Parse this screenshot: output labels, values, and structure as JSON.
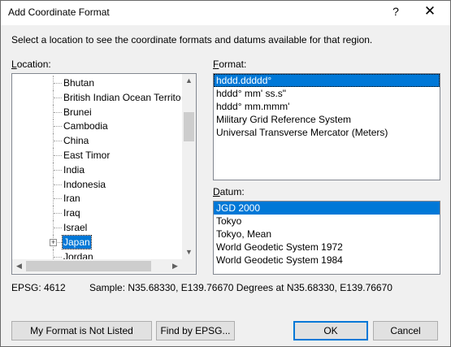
{
  "window": {
    "title": "Add Coordinate Format",
    "help_label": "?",
    "close_label": "✕"
  },
  "instruction": "Select a location to see the coordinate formats and datums available for that region.",
  "location": {
    "label_mnemonic": "L",
    "label_rest": "ocation:",
    "items": [
      {
        "label": "Bhutan",
        "selected": false
      },
      {
        "label": "British Indian Ocean Territory",
        "selected": false
      },
      {
        "label": "Brunei",
        "selected": false
      },
      {
        "label": "Cambodia",
        "selected": false
      },
      {
        "label": "China",
        "selected": false
      },
      {
        "label": "East Timor",
        "selected": false
      },
      {
        "label": "India",
        "selected": false
      },
      {
        "label": "Indonesia",
        "selected": false
      },
      {
        "label": "Iran",
        "selected": false
      },
      {
        "label": "Iraq",
        "selected": false
      },
      {
        "label": "Israel",
        "selected": false
      },
      {
        "label": "Japan",
        "selected": true,
        "expander": "+"
      },
      {
        "label": "Jordan",
        "selected": false
      }
    ]
  },
  "format": {
    "label_mnemonic": "F",
    "label_rest": "ormat:",
    "items": [
      {
        "label": "hddd.ddddd°",
        "selected": true
      },
      {
        "label": "hddd° mm' ss.s\"",
        "selected": false
      },
      {
        "label": "hddd° mm.mmm'",
        "selected": false
      },
      {
        "label": "Military Grid Reference System",
        "selected": false
      },
      {
        "label": "Universal Transverse Mercator (Meters)",
        "selected": false
      }
    ]
  },
  "datum": {
    "label_mnemonic": "D",
    "label_rest": "atum:",
    "items": [
      {
        "label": "JGD 2000",
        "selected": true
      },
      {
        "label": "Tokyo",
        "selected": false
      },
      {
        "label": "Tokyo, Mean",
        "selected": false
      },
      {
        "label": "World Geodetic System 1972",
        "selected": false
      },
      {
        "label": "World Geodetic System 1984",
        "selected": false
      }
    ]
  },
  "status": {
    "epsg": "EPSG: 4612",
    "sample": "Sample: N35.68330, E139.76670 Degrees at N35.68330, E139.76670"
  },
  "buttons": {
    "not_listed": "My Format is Not Listed",
    "find_epsg": "Find by EPSG...",
    "ok": "OK",
    "cancel": "Cancel"
  },
  "colors": {
    "selection": "#0078d7",
    "dialog_bg": "#f0f0f0"
  },
  "icons": {
    "scroll_up": "▲",
    "scroll_down": "▼",
    "scroll_left": "◀",
    "scroll_right": "▶"
  }
}
